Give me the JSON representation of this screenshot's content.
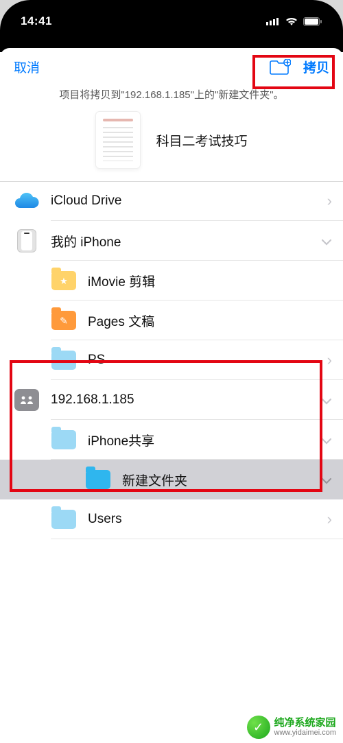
{
  "status": {
    "time": "14:41"
  },
  "header": {
    "cancel": "取消",
    "copy": "拷贝"
  },
  "info": "项目将拷贝到\"192.168.1.185\"上的\"新建文件夹\"。",
  "document": {
    "title": "科目二考试技巧"
  },
  "rows": {
    "icloud": "iCloud Drive",
    "my_iphone": "我的 iPhone",
    "imovie": "iMovie 剪辑",
    "pages": "Pages 文稿",
    "ps": "PS",
    "server": "192.168.1.185",
    "share": "iPhone共享",
    "newfolder": "新建文件夹",
    "users": "Users"
  },
  "watermark": {
    "title": "纯净系统家园",
    "url": "www.yidaimei.com"
  }
}
